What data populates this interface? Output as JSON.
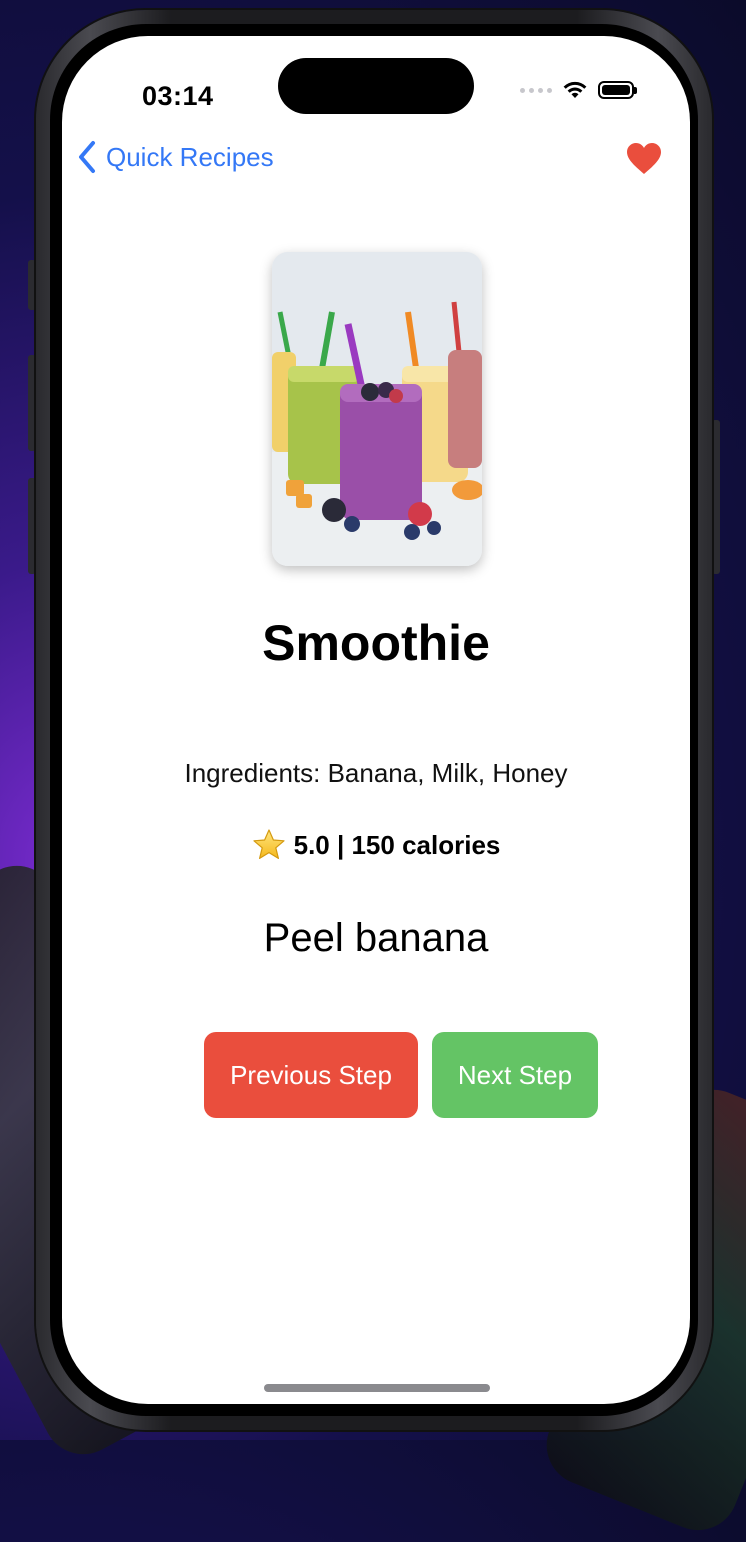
{
  "status_bar": {
    "time": "03:14"
  },
  "nav": {
    "back_label": "Quick Recipes",
    "favorite_icon": "heart-icon"
  },
  "recipe": {
    "title": "Smoothie",
    "ingredients": "Ingredients: Banana, Milk, Honey",
    "rating_icon": "star-icon",
    "rating_text": "5.0 | 150 calories",
    "current_step": "Peel banana"
  },
  "actions": {
    "previous_label": "Previous Step",
    "next_label": "Next Step"
  },
  "colors": {
    "accent": "#3478f6",
    "heart": "#ea4e3d",
    "previous_button": "#ea4e3d",
    "next_button": "#64c465"
  }
}
